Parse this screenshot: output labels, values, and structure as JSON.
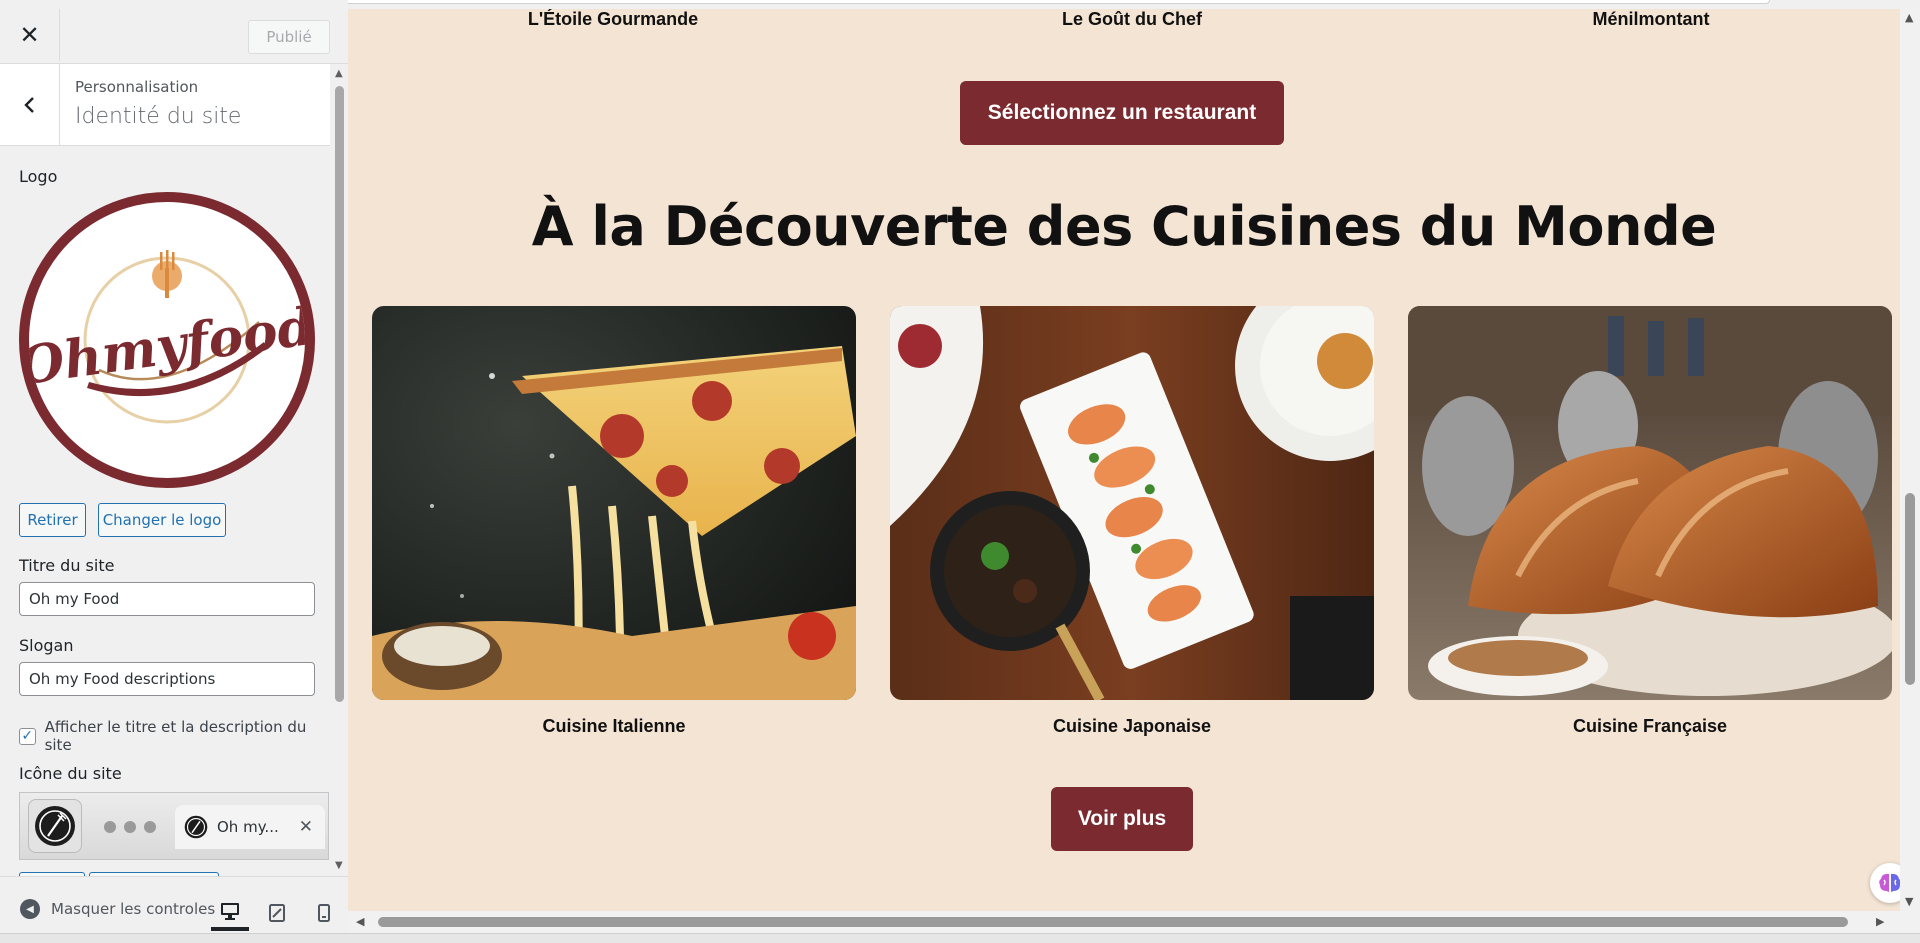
{
  "customizer": {
    "close_symbol": "✕",
    "publish_label": "Publié",
    "breadcrumb": "Personnalisation",
    "section_title": "Identité du site",
    "logo_label": "Logo",
    "logo_text": "Ohmyfood",
    "remove_logo_label": "Retirer",
    "change_logo_label": "Changer le logo",
    "site_title_label": "Titre du site",
    "site_title_value": "Oh my Food",
    "tagline_label": "Slogan",
    "tagline_value": "Oh my Food descriptions",
    "show_title_checkbox_label": "Afficher le titre et la description du site",
    "show_title_checked": true,
    "site_icon_label": "Icône du site",
    "site_icon_tab_text": "Oh my...",
    "tab_close_symbol": "✕",
    "footer": {
      "collapse_label": "Masquer les controles",
      "devices": [
        "desktop",
        "tablet",
        "mobile"
      ],
      "active_device": "desktop"
    }
  },
  "preview": {
    "top_restaurants": [
      "L'Étoile Gourmande",
      "Le Goût du Chef",
      "Ménilmontant"
    ],
    "select_restaurant_button": "Sélectionnez un restaurant",
    "section_heading": "À la Découverte des Cuisines du Monde",
    "cuisines": [
      {
        "label": "Cuisine Italienne",
        "image": "pizza-photo"
      },
      {
        "label": "Cuisine Japonaise",
        "image": "shrimp-platter-photo"
      },
      {
        "label": "Cuisine Française",
        "image": "croissant-cafe-photo"
      }
    ],
    "more_button": "Voir plus"
  },
  "colors": {
    "brand": "#7b2a30",
    "preview_background": "#f4e4d4",
    "wp_blue": "#2271b1",
    "sidebar_background": "#f0f0f1"
  },
  "icons": [
    "close-icon",
    "chevron-left-icon",
    "checkmark-icon",
    "fork-plate-icon",
    "collapse-arrow-icon",
    "desktop-icon",
    "tablet-icon",
    "mobile-icon",
    "brain-icon"
  ]
}
